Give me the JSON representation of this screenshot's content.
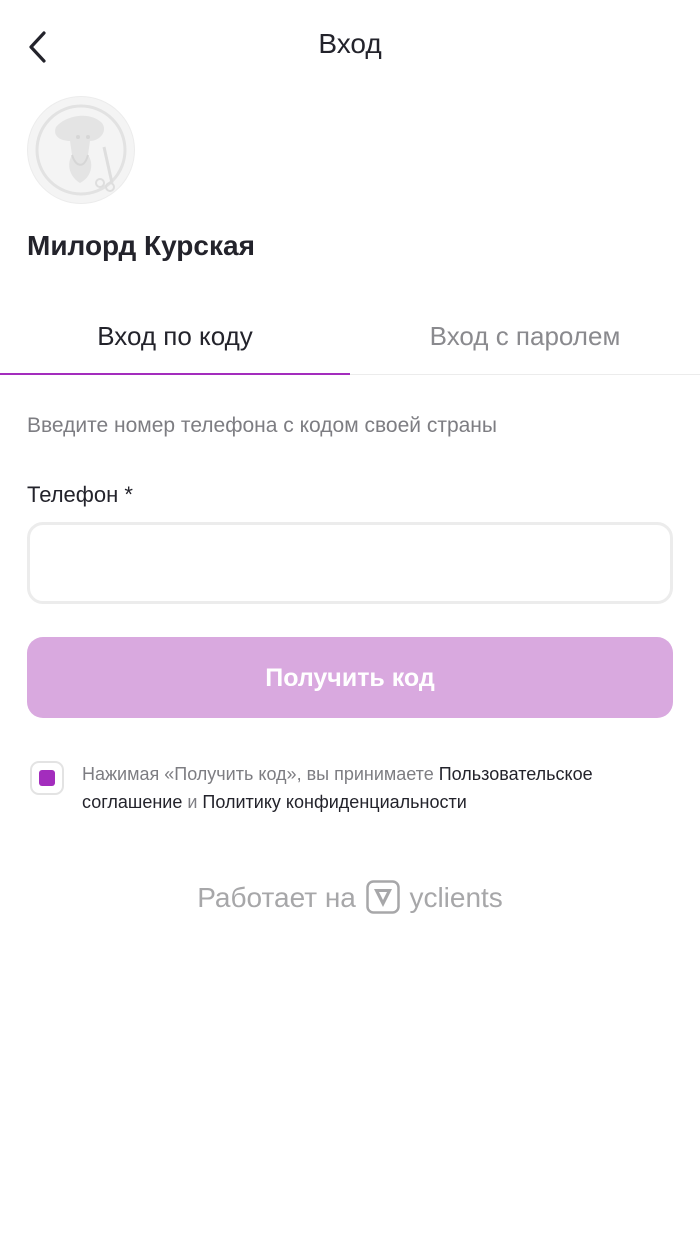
{
  "header": {
    "title": "Вход"
  },
  "company": {
    "name": "Милорд Курская"
  },
  "tabs": [
    {
      "label": "Вход по коду",
      "active": true
    },
    {
      "label": "Вход с паролем",
      "active": false
    }
  ],
  "form": {
    "hint": "Введите номер телефона с кодом своей страны",
    "phone_label": "Телефон *",
    "phone_value": "",
    "submit_label": "Получить код"
  },
  "consent": {
    "checked": true,
    "prefix": "Нажимая «Получить код», вы принимаете ",
    "terms_link": "Пользовательское соглашение",
    "middle": " и ",
    "privacy_link": "Политику конфиденциальности"
  },
  "footer": {
    "powered_prefix": "Работает на",
    "brand": "yclients"
  },
  "colors": {
    "accent": "#a32dbd",
    "button_disabled": "#d9a9df",
    "text_primary": "#23232b",
    "text_secondary": "#7d7d82"
  }
}
